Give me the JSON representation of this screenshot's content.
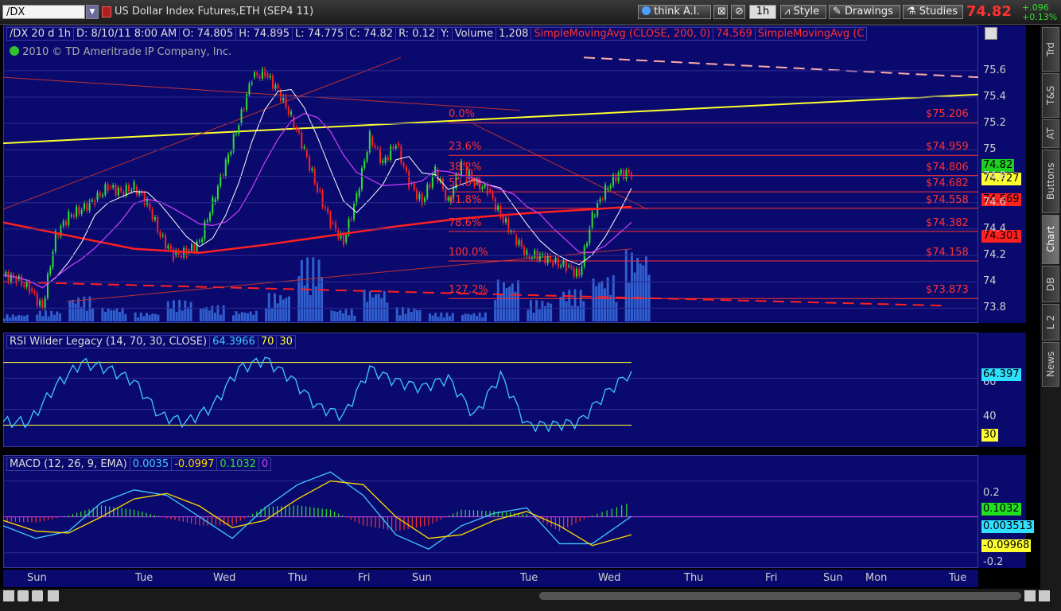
{
  "toolbar": {
    "symbol": "/DX",
    "instrument": "US Dollar Index Futures,ETH (SEP4 11)",
    "think_ai": "think A.I.",
    "interval": "1h",
    "style": "Style",
    "drawings": "Drawings",
    "studies": "Studies",
    "last_price": "74.82",
    "net_change": "+.096",
    "pct_change": "+0.13%"
  },
  "side_tabs": [
    "Trd",
    "T&S",
    "AT",
    "Buttons",
    "Chart",
    "DB",
    "L 2",
    "News"
  ],
  "price_panel": {
    "header": [
      "/DX 20 d 1h",
      "D: 8/10/11 8:00 AM",
      "O: 74.805",
      "H: 74.895",
      "L: 74.775",
      "C: 74.82",
      "R: 0.12",
      "Y:",
      "Volume",
      "1,208",
      "SimpleMovingAvg (CLOSE, 200, 0)",
      "74.569",
      "SimpleMovingAvg (C"
    ],
    "copyright": "2010 © TD Ameritrade IP Company, Inc.",
    "y_ticks": [
      "75.6",
      "75.4",
      "75.2",
      "75",
      "74.8",
      "74.6",
      "74.4",
      "74.2",
      "74",
      "73.8"
    ],
    "fib_prices": [
      "$75.206",
      "$74.959",
      "$74.806",
      "$74.682",
      "$74.558",
      "$74.382",
      "$74.158",
      "$73.873"
    ],
    "fib_pcts": [
      "0.0%",
      "23.6%",
      "38.2%",
      "50.0%",
      "61.8%",
      "78.6%",
      "100.0%",
      "127.2%"
    ],
    "tags": [
      {
        "text": "74.82",
        "bg": "#20d020",
        "fg": "#000"
      },
      {
        "text": "74.727",
        "bg": "#ffff30",
        "fg": "#000"
      },
      {
        "text": "74.569",
        "bg": "#ff2020",
        "fg": "#000"
      },
      {
        "text": "74.301",
        "bg": "#ff2020",
        "fg": "#000"
      }
    ]
  },
  "rsi_panel": {
    "header": [
      "RSI Wilder Legacy (14, 70, 30, CLOSE)",
      "64.3966",
      "70",
      "30"
    ],
    "y_ticks": [
      "60",
      "40"
    ],
    "tags": [
      {
        "text": "64.397",
        "bg": "#30e0ff",
        "fg": "#000"
      },
      {
        "text": "30",
        "bg": "#ffff30",
        "fg": "#000"
      }
    ]
  },
  "macd_panel": {
    "header": [
      "MACD (12, 26, 9, EMA)",
      "0.0035",
      "-0.0997",
      "0.1032",
      "0"
    ],
    "y_ticks": [
      "0.2",
      "-0.2"
    ],
    "tags": [
      {
        "text": "0.1032",
        "bg": "#20e020",
        "fg": "#000"
      },
      {
        "text": "0.003513",
        "bg": "#30e0ff",
        "fg": "#000"
      },
      {
        "text": "-0.09968",
        "bg": "#ffff30",
        "fg": "#000"
      }
    ]
  },
  "x_axis": [
    "Sun",
    "Tue",
    "Wed",
    "Thu",
    "Fri",
    "Sun",
    "Tue",
    "Wed",
    "Thu",
    "Fri",
    "Sun",
    "Mon",
    "Tue"
  ],
  "colors": {
    "panel_bg": "#0a0a6e",
    "price_up": "#30e030",
    "price_down": "#ff2020",
    "sma_white": "#ffffff",
    "sma_magenta": "#d040ff",
    "sma_red": "#ff2020",
    "trend_yellow": "#ffff30",
    "volume": "#3060d0",
    "rsi": "#40c8ff",
    "macd": "#40c8ff",
    "signal": "#ffd800"
  },
  "chart_data": [
    {
      "type": "line",
      "title": "/DX 20 d 1h",
      "ylim": [
        73.7,
        75.75
      ],
      "series": [
        {
          "name": "Price",
          "x": [
            0,
            4,
            8,
            12,
            16,
            20,
            24,
            28,
            32,
            36,
            40,
            44,
            48,
            52,
            56,
            60,
            64,
            68,
            72,
            76,
            80,
            84,
            88,
            92,
            96,
            100,
            104,
            108,
            112,
            116,
            120,
            124,
            128,
            132,
            136,
            140,
            144,
            148,
            152,
            156,
            160,
            164,
            168,
            172,
            176,
            180,
            184,
            188,
            192
          ],
          "values": [
            74.05,
            74.02,
            73.95,
            73.8,
            74.35,
            74.5,
            74.55,
            74.62,
            74.72,
            74.68,
            74.72,
            74.6,
            74.35,
            74.2,
            74.22,
            74.3,
            74.6,
            74.9,
            75.2,
            75.55,
            75.58,
            75.45,
            75.25,
            75.0,
            74.7,
            74.45,
            74.3,
            74.65,
            75.1,
            74.9,
            75.05,
            74.75,
            74.6,
            74.85,
            74.6,
            74.9,
            74.75,
            74.7,
            74.5,
            74.35,
            74.2,
            74.2,
            74.15,
            74.12,
            74.05,
            74.5,
            74.7,
            74.82,
            74.82
          ]
        },
        {
          "name": "SimpleMovingAvg (CLOSE, 200, 0)",
          "x": [
            0,
            20,
            40,
            60,
            80,
            100,
            120,
            140,
            160,
            180,
            192
          ],
          "values": [
            74.45,
            74.35,
            74.25,
            74.22,
            74.28,
            74.35,
            74.42,
            74.48,
            74.52,
            74.55,
            74.569
          ]
        },
        {
          "name": "Volume",
          "x": [
            0,
            10,
            20,
            30,
            40,
            50,
            60,
            70,
            80,
            90,
            100,
            110,
            120,
            130,
            140,
            150,
            160,
            170,
            180,
            190
          ],
          "values": [
            20,
            30,
            70,
            40,
            25,
            60,
            45,
            30,
            80,
            180,
            35,
            90,
            40,
            25,
            25,
            120,
            60,
            90,
            130,
            200
          ]
        }
      ]
    },
    {
      "type": "line",
      "title": "RSI Wilder Legacy (14, 70, 30, CLOSE)",
      "ylim": [
        20,
        80
      ],
      "series": [
        {
          "name": "RSI",
          "x": [
            0,
            8,
            16,
            24,
            32,
            40,
            48,
            56,
            64,
            72,
            80,
            88,
            96,
            104,
            112,
            120,
            128,
            136,
            144,
            152,
            160,
            168,
            176,
            184,
            192
          ],
          "values": [
            32,
            32,
            55,
            70,
            66,
            58,
            36,
            32,
            42,
            66,
            72,
            60,
            42,
            36,
            66,
            58,
            54,
            60,
            36,
            62,
            30,
            30,
            32,
            50,
            64.4
          ]
        }
      ]
    },
    {
      "type": "line",
      "title": "MACD (12, 26, 9, EMA)",
      "ylim": [
        -0.25,
        0.3
      ],
      "series": [
        {
          "name": "MACD",
          "x": [
            0,
            10,
            20,
            30,
            40,
            50,
            60,
            70,
            80,
            90,
            100,
            110,
            120,
            130,
            140,
            150,
            160,
            170,
            180,
            192
          ],
          "values": [
            -0.05,
            -0.12,
            -0.08,
            0.08,
            0.15,
            0.12,
            0.0,
            -0.12,
            0.05,
            0.18,
            0.25,
            0.12,
            -0.1,
            -0.18,
            -0.05,
            0.02,
            0.05,
            -0.15,
            -0.15,
            0.0035
          ]
        },
        {
          "name": "Signal",
          "x": [
            0,
            10,
            20,
            30,
            40,
            50,
            60,
            70,
            80,
            90,
            100,
            110,
            120,
            130,
            140,
            150,
            160,
            170,
            180,
            192
          ],
          "values": [
            -0.02,
            -0.08,
            -0.09,
            0.0,
            0.1,
            0.13,
            0.06,
            -0.06,
            -0.02,
            0.1,
            0.2,
            0.18,
            0.0,
            -0.12,
            -0.1,
            -0.02,
            0.03,
            -0.05,
            -0.16,
            -0.0997
          ]
        }
      ]
    }
  ]
}
